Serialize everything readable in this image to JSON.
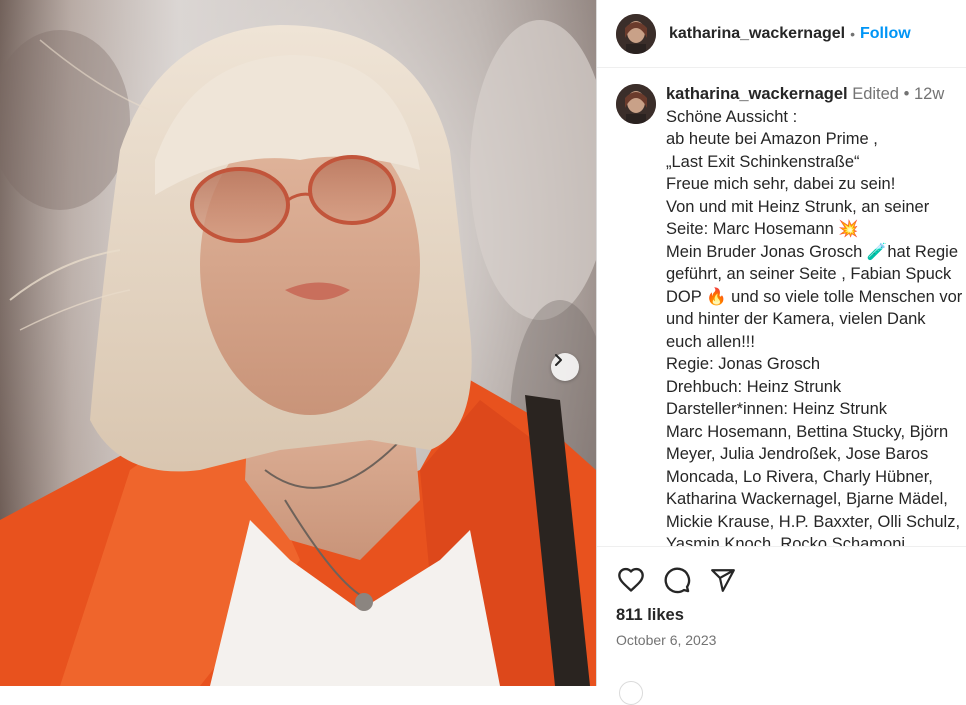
{
  "post": {
    "username": "katharina_wackernagel",
    "follow_label": "Follow",
    "separator": "•",
    "edited_label": "Edited",
    "age": "12w",
    "caption_lines": [
      "Schöne Aussicht :",
      "ab heute bei Amazon Prime ,",
      "„Last Exit Schinkenstraße“",
      "Freue mich sehr, dabei zu sein!",
      "Von und mit Heinz Strunk, an seiner",
      "Seite: Marc Hosemann 💥",
      "Mein Bruder Jonas Grosch 🧪hat Regie",
      "geführt, an seiner Seite , Fabian Spuck",
      "DOP 🔥 und so viele tolle Menschen vor",
      "und hinter der Kamera, vielen Dank",
      "euch allen!!!",
      "Regie: Jonas Grosch",
      "Drehbuch: Heinz Strunk",
      "Darsteller*innen: Heinz Strunk",
      "Marc Hosemann, Bettina Stucky, Björn",
      "Meyer, Julia Jendroßek, Jose Baros",
      "Moncada, Lo Rivera, Charly Hübner,",
      "Katharina Wackernagel, Bjarne Mädel,",
      "Mickie Krause, H.P. Baxxter, Olli Schulz,",
      "Yasmin Knoch, Rocko Schamoni"
    ],
    "likes": "811 likes",
    "date": "October 6, 2023"
  },
  "icons": {
    "like": "heart-icon",
    "comment": "comment-icon",
    "share": "share-icon",
    "next": "chevron-right-icon"
  },
  "colors": {
    "accent": "#0095f6",
    "secondary_text": "#737373",
    "jacket": "#e8521e"
  }
}
